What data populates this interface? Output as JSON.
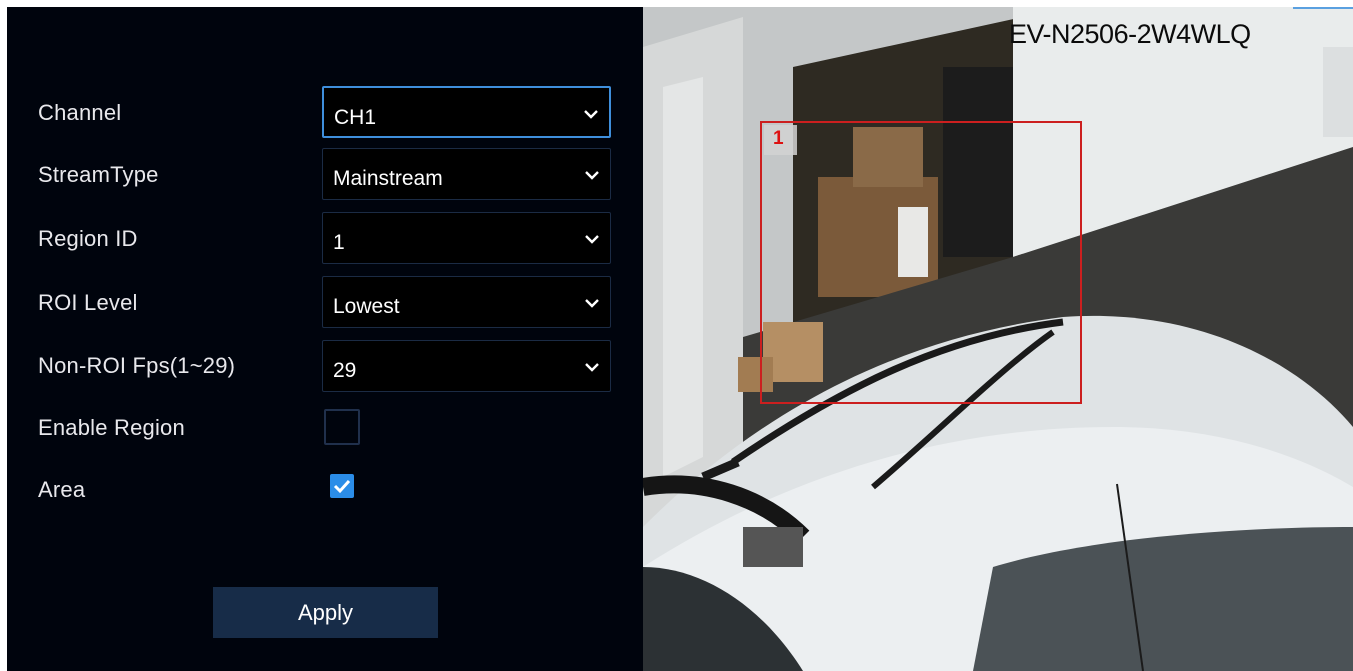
{
  "settings": {
    "channel": {
      "label": "Channel",
      "value": "CH1"
    },
    "stream_type": {
      "label": "StreamType",
      "value": "Mainstream"
    },
    "region_id": {
      "label": "Region ID",
      "value": "1"
    },
    "roi_level": {
      "label": "ROI Level",
      "value": "Lowest"
    },
    "non_roi_fps": {
      "label": "Non-ROI Fps(1~29)",
      "value": "29"
    },
    "enable_region": {
      "label": "Enable Region",
      "checked": false
    },
    "area": {
      "label": "Area",
      "checked": true
    },
    "apply_label": "Apply"
  },
  "preview": {
    "camera_name": "EV-N2506-2W4WLQ",
    "roi_region_label": "1"
  },
  "icons": {
    "dropdown": "chevron-down-icon",
    "check": "check-icon"
  },
  "colors": {
    "panel_bg": "#00040d",
    "accent": "#2b8de8",
    "button_bg": "#172c48",
    "roi_border": "#cc1f1f"
  }
}
